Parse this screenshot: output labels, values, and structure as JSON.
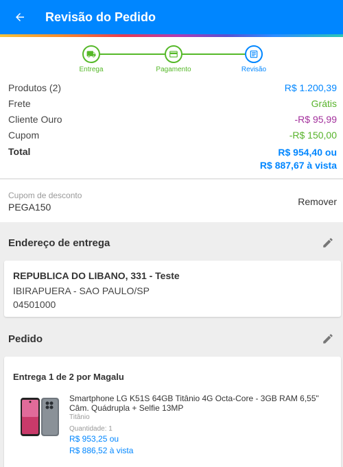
{
  "header": {
    "title": "Revisão do Pedido"
  },
  "steps": [
    {
      "label": "Entrega",
      "icon": "truck-icon"
    },
    {
      "label": "Pagamento",
      "icon": "payment-icon"
    },
    {
      "label": "Revisão",
      "icon": "review-icon"
    }
  ],
  "summary": {
    "products_label": "Produtos (2)",
    "products_value": "R$ 1.200,39",
    "shipping_label": "Frete",
    "shipping_value": "Grátis",
    "gold_label": "Cliente Ouro",
    "gold_value": "-R$ 95,99",
    "coupon_label": "Cupom",
    "coupon_value": "-R$ 150,00",
    "total_label": "Total",
    "total_value": "R$ 954,40 ou",
    "total_cash": "R$ 887,67 à vista"
  },
  "coupon": {
    "label": "Cupom de desconto",
    "code": "PEGA150",
    "remove_label": "Remover"
  },
  "address": {
    "section_title": "Endereço de entrega",
    "line1": "REPUBLICA DO LIBANO, 331 - Teste",
    "line2": "IBIRAPUERA - SAO PAULO/SP",
    "line3": "04501000"
  },
  "order": {
    "section_title": "Pedido",
    "delivery_title": "Entrega 1 de 2 por Magalu",
    "product_name": "Smartphone LG K51S 64GB Titânio 4G Octa-Core - 3GB RAM 6,55\" Câm. Quádrupla + Selfie 13MP",
    "product_color": "Titânio",
    "quantity": "Quantidade:  1",
    "price": "R$ 953,25 ou",
    "price_cash": "R$ 886,52 à vista"
  },
  "colors": {
    "primary": "#0086ff",
    "green": "#57b32a",
    "purple": "#a3309c"
  }
}
